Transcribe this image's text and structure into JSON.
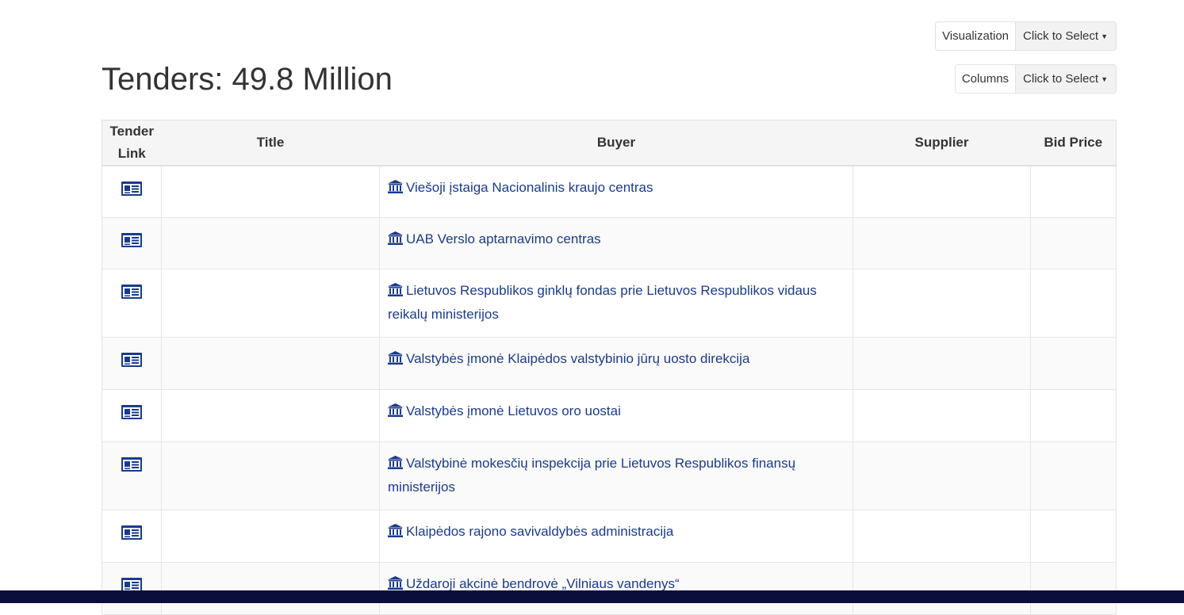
{
  "header": {
    "title": "Tenders: 49.8 Million"
  },
  "controls": {
    "visualization": {
      "label": "Visualization",
      "value": "Click to Select"
    },
    "columns": {
      "label": "Columns",
      "value": "Click to Select"
    }
  },
  "table": {
    "columns": [
      "Tender Link",
      "Title",
      "Buyer",
      "Supplier",
      "Bid Price"
    ],
    "column_header_lines": {
      "tender_link": [
        "Tender",
        "Link"
      ]
    },
    "rows": [
      {
        "buyer": "Viešoji įstaiga Nacionalinis kraujo centras"
      },
      {
        "buyer": "UAB Verslo aptarnavimo centras"
      },
      {
        "buyer": "Lietuvos Respublikos ginklų fondas prie Lietuvos Respublikos vidaus reikalų ministerijos"
      },
      {
        "buyer": "Valstybės įmonė Klaipėdos valstybinio jūrų uosto direkcija"
      },
      {
        "buyer": "Valstybės įmonė Lietuvos oro uostai"
      },
      {
        "buyer": "Valstybinė mokesčių inspekcija prie Lietuvos Respublikos finansų ministerijos"
      },
      {
        "buyer": "Klaipėdos rajono savivaldybės administracija"
      },
      {
        "buyer": "Uždaroji akcinė bendrovė „Vilniaus vandenys“"
      }
    ]
  },
  "icons": {
    "tender_link": "document-icon",
    "buyer": "institution-icon"
  },
  "colors": {
    "link": "#1a3b8c",
    "footer": "#0b0d3a",
    "header_bg": "#f5f5f5"
  }
}
